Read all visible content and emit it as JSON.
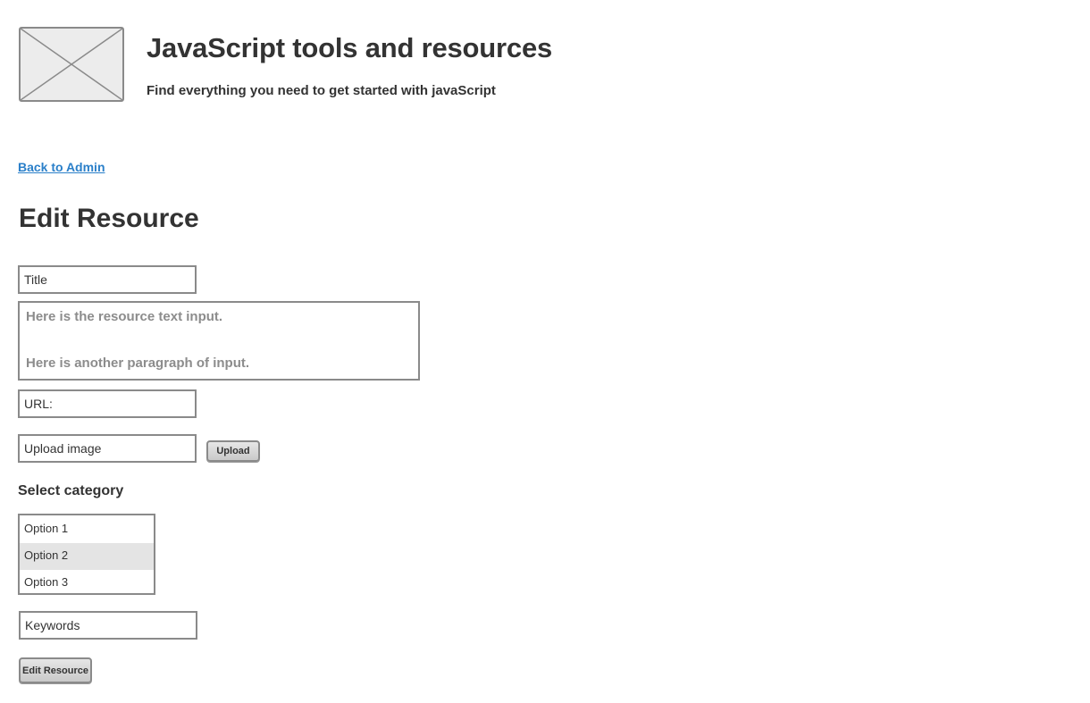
{
  "header": {
    "logo": "image-placeholder-icon",
    "title": "JavaScript tools and resources",
    "subtitle": "Find everything you need to get started with javaScript"
  },
  "nav": {
    "back_link": "Back to Admin"
  },
  "page": {
    "heading": "Edit Resource"
  },
  "form": {
    "title_placeholder": "Title",
    "body_paragraphs": [
      "Here is the resource text input.",
      "Here is another paragraph of input."
    ],
    "url_placeholder": "URL:",
    "upload_placeholder": "Upload image",
    "upload_button": "Upload",
    "category_label": "Select category",
    "category_options": [
      "Option 1",
      "Option 2",
      "Option 3"
    ],
    "category_selected": "Option 2",
    "keywords_placeholder": "Keywords",
    "submit_button": "Edit Resource"
  },
  "colors": {
    "link": "#2a7fc9",
    "text": "#333333",
    "border": "#8a8a8a",
    "selected_option_bg": "#e4e4e4"
  }
}
